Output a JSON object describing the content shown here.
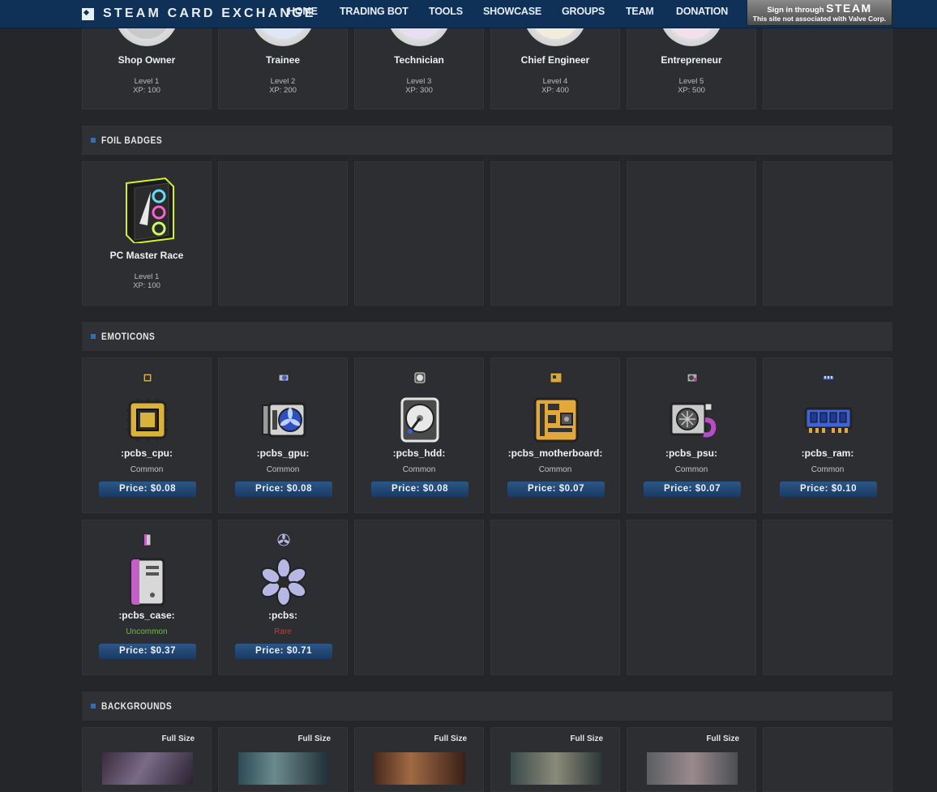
{
  "header": {
    "logo_text": "STEAM CARD EXCHANGE",
    "nav": [
      "HOME",
      "TRADING BOT",
      "TOOLS",
      "SHOWCASE",
      "GROUPS",
      "TEAM",
      "DONATION"
    ],
    "signin_line1": "Sign in through",
    "signin_brand": "STEAM",
    "signin_line2": "This site not associated with Valve Corp."
  },
  "badges": [
    {
      "name": "Shop Owner",
      "level": "Level 1",
      "xp": "XP: 100"
    },
    {
      "name": "Trainee",
      "level": "Level 2",
      "xp": "XP: 200"
    },
    {
      "name": "Technician",
      "level": "Level 3",
      "xp": "XP: 300"
    },
    {
      "name": "Chief Engineer",
      "level": "Level 4",
      "xp": "XP: 400"
    },
    {
      "name": "Entrepreneur",
      "level": "Level 5",
      "xp": "XP: 500"
    }
  ],
  "foil_section": {
    "title": "FOIL BADGES",
    "badges": [
      {
        "name": "PC Master Race",
        "level": "Level 1",
        "xp": "XP: 100"
      }
    ]
  },
  "emoticons_section": {
    "title": "EMOTICONS",
    "items": [
      {
        "name": ":pcbs_cpu:",
        "rarity": "Common",
        "price": "Price: $0.08",
        "icon": "cpu-icon"
      },
      {
        "name": ":pcbs_gpu:",
        "rarity": "Common",
        "price": "Price: $0.08",
        "icon": "gpu-icon"
      },
      {
        "name": ":pcbs_hdd:",
        "rarity": "Common",
        "price": "Price: $0.08",
        "icon": "hdd-icon"
      },
      {
        "name": ":pcbs_motherboard:",
        "rarity": "Common",
        "price": "Price: $0.07",
        "icon": "motherboard-icon"
      },
      {
        "name": ":pcbs_psu:",
        "rarity": "Common",
        "price": "Price: $0.07",
        "icon": "psu-icon"
      },
      {
        "name": ":pcbs_ram:",
        "rarity": "Common",
        "price": "Price: $0.10",
        "icon": "ram-icon"
      },
      {
        "name": ":pcbs_case:",
        "rarity": "Uncommon",
        "price": "Price: $0.37",
        "icon": "case-icon"
      },
      {
        "name": ":pcbs:",
        "rarity": "Rare",
        "price": "Price: $0.71",
        "icon": "fan-icon"
      }
    ]
  },
  "rarity_colors": {
    "Common": "#c4c6c9",
    "Uncommon": "#6ac03b",
    "Rare": "#d0382c"
  },
  "backgrounds_section": {
    "title": "BACKGROUNDS",
    "full_size_label": "Full Size",
    "count_shown": 5
  }
}
